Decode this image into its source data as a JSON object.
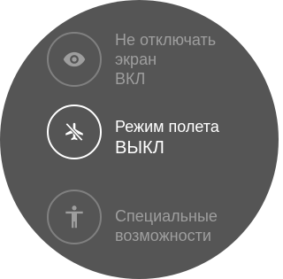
{
  "screen": {
    "items": [
      {
        "label_line1": "Не отключать",
        "label_line2": "экран",
        "state": "ВКЛ",
        "icon": "eye-icon"
      },
      {
        "label_line1": "Режим полета",
        "state": "ВЫКЛ",
        "icon": "airplane-off-icon"
      },
      {
        "label_line1": "Специальные",
        "label_line2": "возможности",
        "icon": "accessibility-icon"
      }
    ]
  },
  "colors": {
    "background": "#555555",
    "text_active": "#ffffff",
    "text_inactive": "#9e9e9e",
    "ring_inactive": "#808080",
    "ring_active": "#ffffff"
  }
}
